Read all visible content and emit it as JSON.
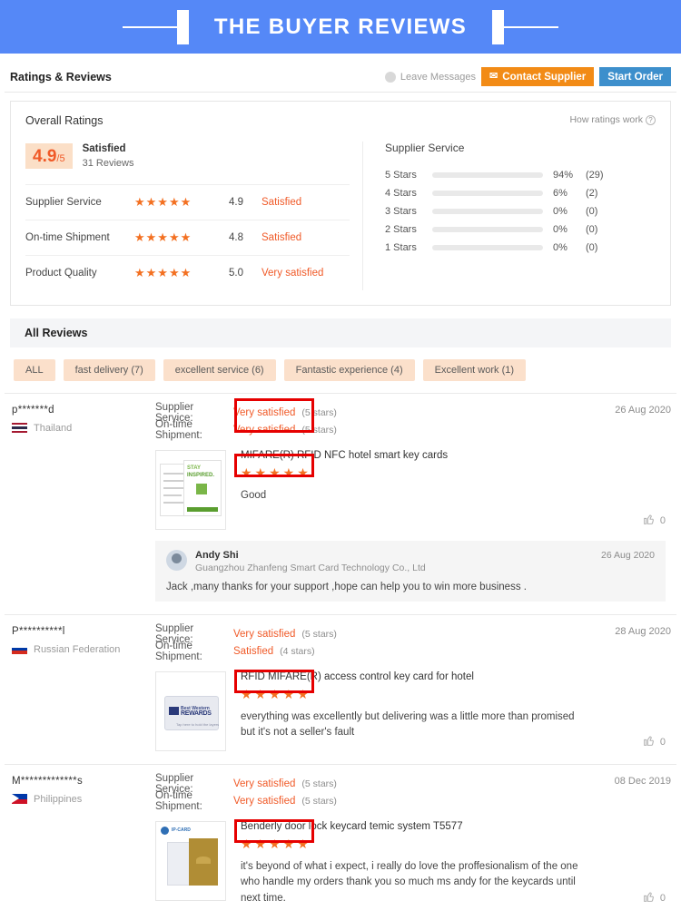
{
  "banner": {
    "title": "THE BUYER REVIEWS",
    "bg_color": "#5588f7"
  },
  "header": {
    "title": "Ratings & Reviews",
    "leave_messages": "Leave Messages",
    "contact_supplier": "Contact Supplier",
    "start_order": "Start Order",
    "contact_color": "#f28b16",
    "start_color": "#3d8fcc"
  },
  "overall": {
    "title": "Overall Ratings",
    "how_ratings_work": "How ratings work",
    "score": "4.9",
    "score_denominator": "/5",
    "score_label": "Satisfied",
    "review_count": "31 Reviews",
    "metrics": [
      {
        "name": "Supplier Service",
        "stars": "★★★★★",
        "value": "4.9",
        "word": "Satisfied"
      },
      {
        "name": "On-time Shipment",
        "stars": "★★★★★",
        "value": "4.8",
        "word": "Satisfied"
      },
      {
        "name": "Product Quality",
        "stars": "★★★★★",
        "value": "5.0",
        "word": "Very satisfied"
      }
    ],
    "distribution_title": "Supplier Service",
    "distribution": [
      {
        "label": "5 Stars",
        "pct": "94%",
        "count": "(29)",
        "fill": 94
      },
      {
        "label": "4 Stars",
        "pct": "6%",
        "count": "(2)",
        "fill": 6
      },
      {
        "label": "3 Stars",
        "pct": "0%",
        "count": "(0)",
        "fill": 0
      },
      {
        "label": "2 Stars",
        "pct": "0%",
        "count": "(0)",
        "fill": 0
      },
      {
        "label": "1 Stars",
        "pct": "0%",
        "count": "(0)",
        "fill": 0
      }
    ]
  },
  "chart_data": {
    "type": "bar",
    "title": "Supplier Service",
    "categories": [
      "5 Stars",
      "4 Stars",
      "3 Stars",
      "2 Stars",
      "1 Stars"
    ],
    "values": [
      94,
      6,
      0,
      0,
      0
    ],
    "counts": [
      29,
      2,
      0,
      0,
      0
    ],
    "xlabel": "",
    "ylabel": "",
    "xlim": [
      0,
      100
    ],
    "grid": false,
    "legend": "none",
    "orientation": "horizontal",
    "bar_color": "#ef7d1a",
    "track_color": "#e9e9e9"
  },
  "all_reviews": {
    "title": "All Reviews",
    "tags": [
      "ALL",
      "fast delivery (7)",
      "excellent service (6)",
      "Fantastic experience (4)",
      "Excellent work (1)"
    ]
  },
  "reviews": [
    {
      "user": "p*******d",
      "country": "Thailand",
      "flag": "flag-th",
      "date": "26 Aug 2020",
      "supplier_service_label": "Supplier Service:",
      "supplier_service_word": "Very satisfied",
      "supplier_service_stars": "(5 stars)",
      "shipment_label": "On-time Shipment:",
      "shipment_word": "Very satisfied",
      "shipment_stars": "(5 stars)",
      "product_title": "MIFARE(R) RFID NFC hotel smart key cards",
      "product_stars": "★★★★★",
      "text": "Good",
      "likes": "0",
      "reply": {
        "name": "Andy Shi",
        "company": "Guangzhou Zhanfeng Smart Card Technology Co., Ltd",
        "date": "26 Aug 2020",
        "text": "Jack ,many thanks for your support ,hope can help you to win more business ."
      }
    },
    {
      "user": "P**********l",
      "country": "Russian Federation",
      "flag": "flag-ru",
      "date": "28 Aug 2020",
      "supplier_service_label": "Supplier Service:",
      "supplier_service_word": "Very satisfied",
      "supplier_service_stars": "(5 stars)",
      "shipment_label": "On-time Shipment:",
      "shipment_word": "Satisfied",
      "shipment_stars": "(4 stars)",
      "product_title": "RFID MIFARE(R) access control key card for hotel",
      "product_stars": "★★★★★",
      "text": "everything was excellently but delivering was a little more than promised but it's not a seller's fault",
      "likes": "0"
    },
    {
      "user": "M*************s",
      "country": "Philippines",
      "flag": "flag-ph",
      "date": "08 Dec 2019",
      "supplier_service_label": "Supplier Service:",
      "supplier_service_word": "Very satisfied",
      "supplier_service_stars": "(5 stars)",
      "shipment_label": "On-time Shipment:",
      "shipment_word": "Very satisfied",
      "shipment_stars": "(5 stars)",
      "product_title": "Benderly door lock keycard temic system T5577",
      "product_stars": "★★★★★",
      "text": "it's beyond of what i expect, i really do love the proffesionalism  of the one who handle my orders thank you so much ms andy for the keycards until next time.",
      "likes": "0"
    }
  ],
  "icons": {
    "mail": "✉",
    "thumb_up": "⍾",
    "question": "?"
  }
}
